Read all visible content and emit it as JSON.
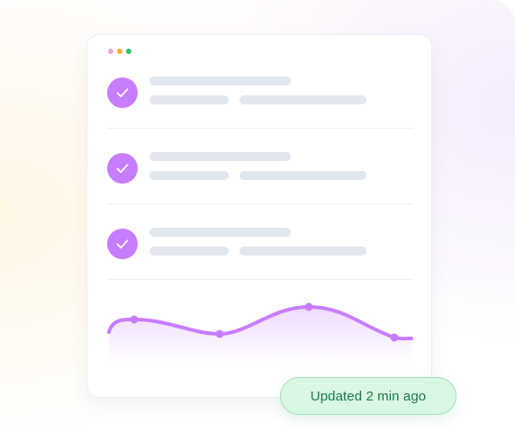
{
  "colors": {
    "accent": "#c77dff",
    "skeleton": "#e2e6ee",
    "dot_pink": "#f6a6d8",
    "dot_orange": "#f7a93c",
    "dot_green": "#2fbf71",
    "toast_bg": "#d9f7e3",
    "toast_text": "#197a44"
  },
  "window_controls": [
    "pink-dot",
    "orange-dot",
    "green-dot"
  ],
  "tasks": [
    {
      "status": "completed",
      "icon": "check-icon"
    },
    {
      "status": "completed",
      "icon": "check-icon"
    },
    {
      "status": "completed",
      "icon": "check-icon"
    }
  ],
  "trend_chart": {
    "type": "area",
    "markers": 4
  },
  "status": {
    "text": "Updated 2 min ago"
  }
}
